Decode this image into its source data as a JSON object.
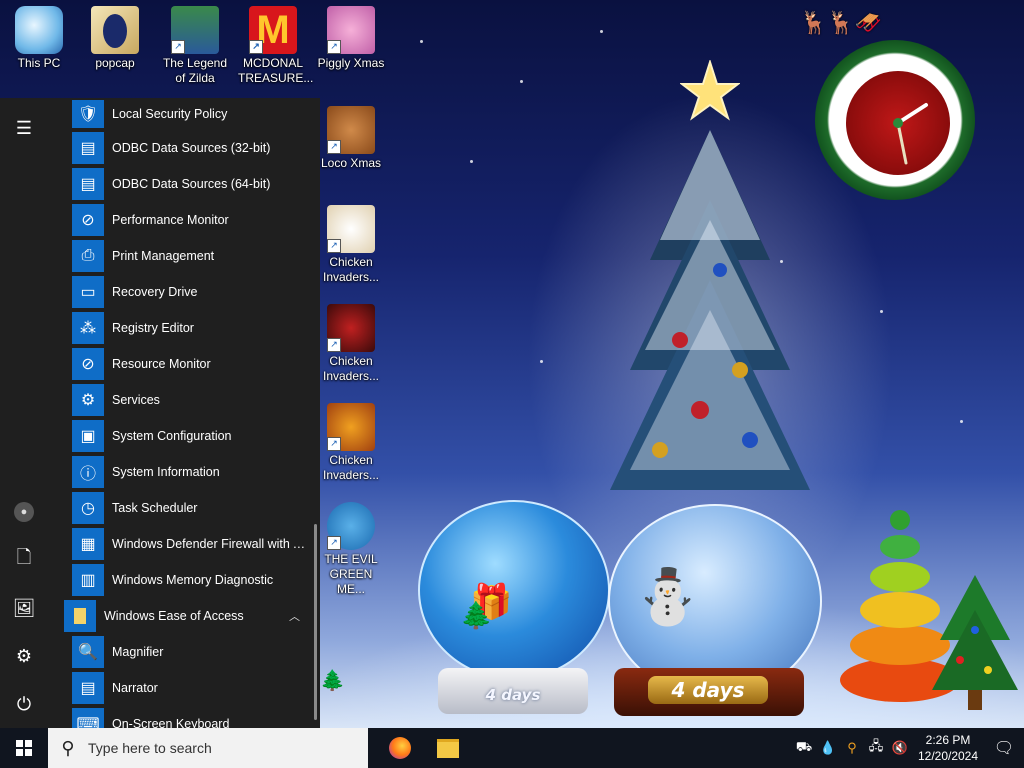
{
  "desktop": {
    "icons": [
      {
        "label": "This PC",
        "icon": "computer-icon"
      },
      {
        "label": "popcap",
        "icon": "folder-icon"
      },
      {
        "label": "The Legend of Zilda",
        "icon": "game-shortcut-icon"
      },
      {
        "label": "MCDONAL TREASURE...",
        "icon": "mcdonalds-shortcut-icon"
      },
      {
        "label": "Piggly Xmas",
        "icon": "pig-shortcut-icon"
      },
      {
        "label": "Loco Xmas",
        "icon": "bear-shortcut-icon"
      },
      {
        "label": "Chicken Invaders...",
        "icon": "chicken-shortcut-icon"
      },
      {
        "label": "Chicken Invaders...",
        "icon": "chicken-shortcut-icon"
      },
      {
        "label": "Chicken Invaders...",
        "icon": "chicken-shortcut-icon"
      },
      {
        "label": "THE EVIL GREEN ME...",
        "icon": "users-shortcut-icon"
      }
    ],
    "countdown_left": "4 days",
    "countdown_right": "4 days"
  },
  "start_menu": {
    "rail": {
      "menu": "hamburger-icon",
      "user": "user-icon",
      "documents": "document-icon",
      "pictures": "pictures-icon",
      "settings": "gear-icon",
      "power": "power-icon"
    },
    "apps": [
      {
        "label": "Local Security Policy",
        "icon": "security-policy-icon"
      },
      {
        "label": "ODBC Data Sources (32-bit)",
        "icon": "odbc-icon"
      },
      {
        "label": "ODBC Data Sources (64-bit)",
        "icon": "odbc-icon"
      },
      {
        "label": "Performance Monitor",
        "icon": "performance-icon"
      },
      {
        "label": "Print Management",
        "icon": "printer-icon"
      },
      {
        "label": "Recovery Drive",
        "icon": "drive-icon"
      },
      {
        "label": "Registry Editor",
        "icon": "registry-icon"
      },
      {
        "label": "Resource Monitor",
        "icon": "resource-monitor-icon"
      },
      {
        "label": "Services",
        "icon": "services-gear-icon"
      },
      {
        "label": "System Configuration",
        "icon": "system-config-icon"
      },
      {
        "label": "System Information",
        "icon": "system-info-icon"
      },
      {
        "label": "Task Scheduler",
        "icon": "clock-icon"
      },
      {
        "label": "Windows Defender Firewall with A...",
        "icon": "firewall-icon"
      },
      {
        "label": "Windows Memory Diagnostic",
        "icon": "memory-icon"
      }
    ],
    "folder": {
      "label": "Windows Ease of Access",
      "icon": "folder-icon",
      "expanded": true
    },
    "folder_apps": [
      {
        "label": "Magnifier",
        "icon": "magnifier-icon"
      },
      {
        "label": "Narrator",
        "icon": "narrator-icon"
      },
      {
        "label": "On-Screen Keyboard",
        "icon": "keyboard-icon"
      }
    ]
  },
  "taskbar": {
    "search_placeholder": "Type here to search",
    "pinned": [
      {
        "name": "Firefox",
        "icon": "firefox-icon"
      },
      {
        "name": "File Explorer",
        "icon": "file-explorer-icon"
      }
    ],
    "time": "2:26 PM",
    "date": "12/20/2024"
  },
  "colors": {
    "start_bg": "#1f1f1f",
    "tile_blue": "#0f6dc7",
    "taskbar_bg": "#10151f",
    "search_bg": "#f2f2f2"
  }
}
